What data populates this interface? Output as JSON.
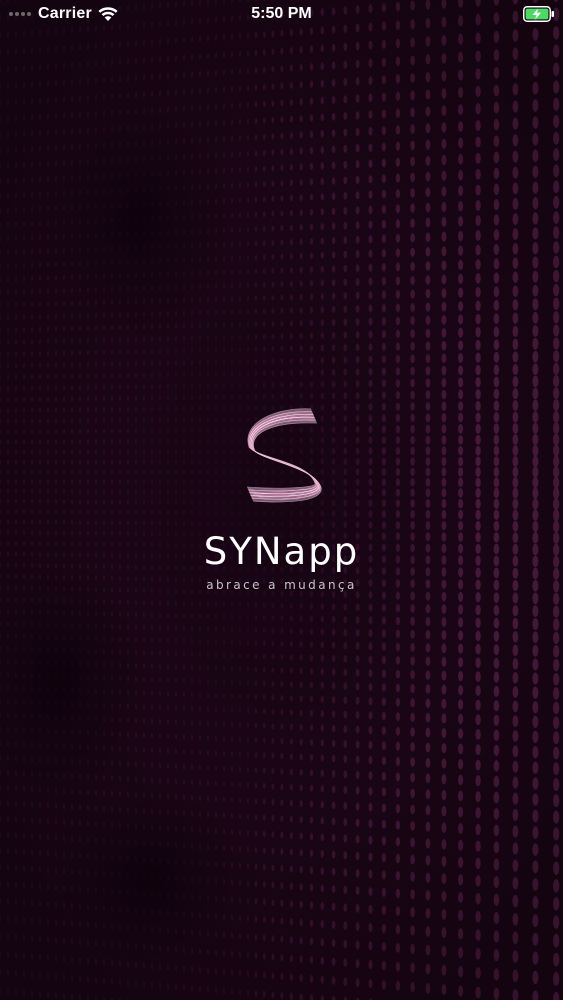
{
  "status_bar": {
    "carrier": "Carrier",
    "time": "5:50 PM",
    "battery_state": "charging",
    "battery_color": "#4cd964"
  },
  "splash": {
    "app_name": "SYNapp",
    "tagline": "abrace a mudança",
    "logo_icon": "synapp-wave-logo-icon",
    "logo_color": "#d98ab8",
    "background_color": "#160412",
    "dot_color": "#7a2f66"
  }
}
